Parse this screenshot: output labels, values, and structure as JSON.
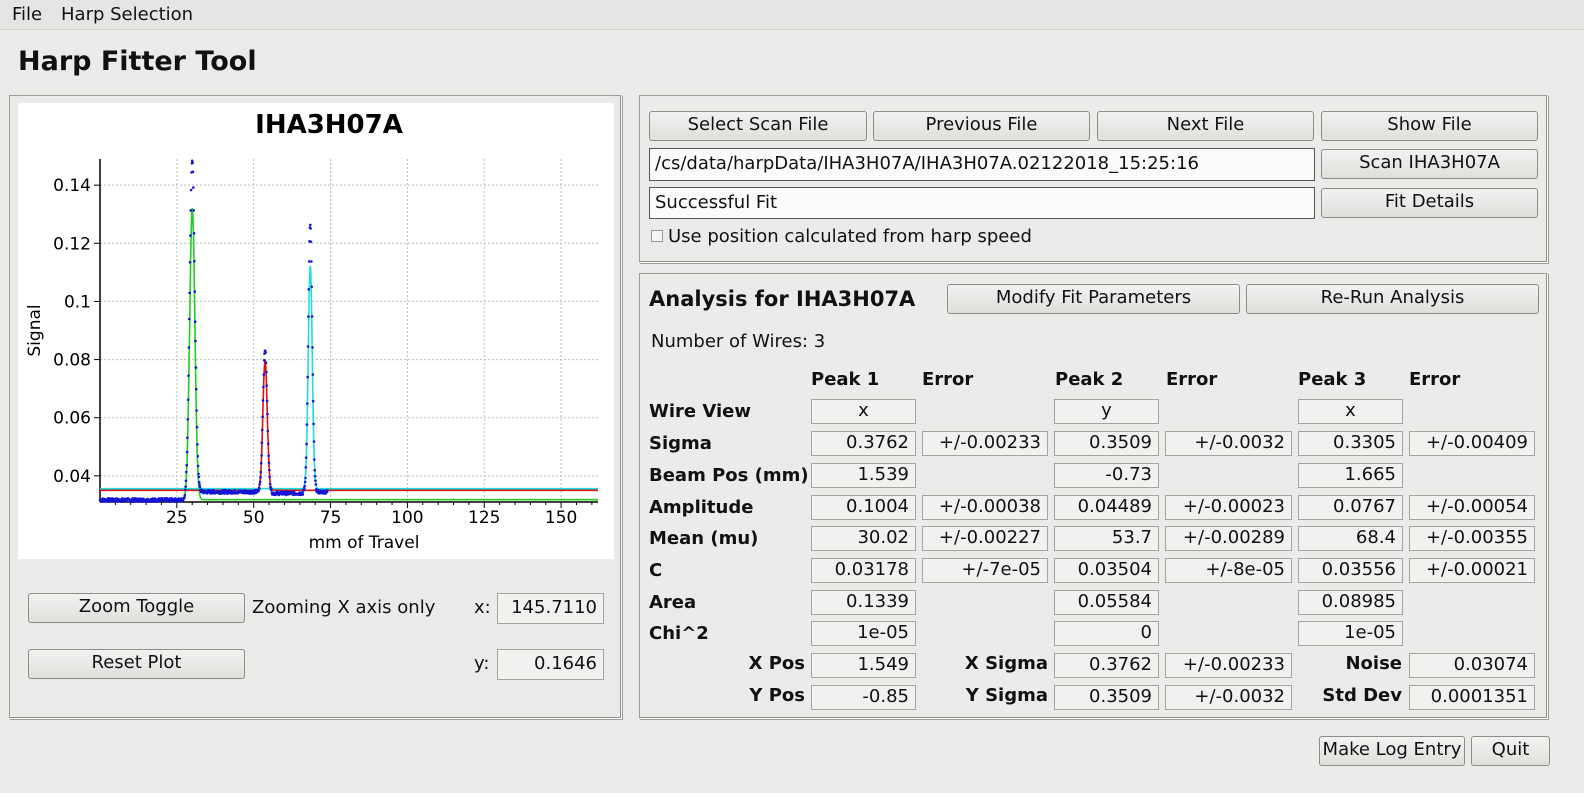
{
  "menu": {
    "file": "File",
    "harp_selection": "Harp Selection"
  },
  "app_title": "Harp Fitter Tool",
  "file_controls": {
    "select_scan": "Select Scan File",
    "previous_file": "Previous File",
    "next_file": "Next File",
    "show_file": "Show File",
    "file_path": "/cs/data/harpData/IHA3H07A/IHA3H07A.02122018_15:25:16",
    "scan_button": "Scan IHA3H07A",
    "status_text": "Successful Fit",
    "fit_details": "Fit Details",
    "use_position_label": "Use position calculated from harp speed",
    "use_position_checked": false
  },
  "plot_controls": {
    "zoom_toggle": "Zoom Toggle",
    "zoom_mode": "Zooming X axis only",
    "reset_plot": "Reset Plot",
    "x_label": "x:",
    "x_value": "145.7110",
    "y_label": "y:",
    "y_value": "0.1646"
  },
  "analysis": {
    "title": "Analysis for IHA3H07A",
    "modify_fit": "Modify Fit Parameters",
    "rerun": "Re-Run Analysis",
    "num_wires": "Number of Wires: 3",
    "headers": [
      "Peak 1",
      "Error",
      "Peak 2",
      "Error",
      "Peak 3",
      "Error"
    ],
    "rows": [
      {
        "label": "Wire View",
        "p1": "x",
        "e1": "",
        "p2": "y",
        "e2": "",
        "p3": "x",
        "e3": ""
      },
      {
        "label": "Sigma",
        "p1": "0.3762",
        "e1": "+/-0.00233",
        "p2": "0.3509",
        "e2": "+/-0.0032",
        "p3": "0.3305",
        "e3": "+/-0.00409"
      },
      {
        "label": "Beam Pos (mm)",
        "p1": "1.539",
        "e1": "",
        "p2": "-0.73",
        "e2": "",
        "p3": "1.665",
        "e3": ""
      },
      {
        "label": "Amplitude",
        "p1": "0.1004",
        "e1": "+/-0.00038",
        "p2": "0.04489",
        "e2": "+/-0.00023",
        "p3": "0.0767",
        "e3": "+/-0.00054"
      },
      {
        "label": "Mean (mu)",
        "p1": "30.02",
        "e1": "+/-0.00227",
        "p2": "53.7",
        "e2": "+/-0.00289",
        "p3": "68.4",
        "e3": "+/-0.00355"
      },
      {
        "label": "C",
        "p1": "0.03178",
        "e1": "+/-7e-05",
        "p2": "0.03504",
        "e2": "+/-8e-05",
        "p3": "0.03556",
        "e3": "+/-0.00021"
      },
      {
        "label": "Area",
        "p1": "0.1339",
        "e1": "",
        "p2": "0.05584",
        "e2": "",
        "p3": "0.08985",
        "e3": ""
      },
      {
        "label": "Chi^2",
        "p1": "1e-05",
        "e1": "",
        "p2": "0",
        "e2": "",
        "p3": "1e-05",
        "e3": ""
      }
    ],
    "summary": {
      "x_pos_label": "X Pos",
      "x_pos": "1.549",
      "y_pos_label": "Y Pos",
      "y_pos": "-0.85",
      "x_sigma_label": "X Sigma",
      "x_sigma": "0.3762",
      "x_sigma_err": "+/-0.00233",
      "y_sigma_label": "Y Sigma",
      "y_sigma": "0.3509",
      "y_sigma_err": "+/-0.0032",
      "noise_label": "Noise",
      "noise": "0.03074",
      "std_dev_label": "Std Dev",
      "std_dev": "0.0001351"
    }
  },
  "footer": {
    "make_log_entry": "Make Log Entry",
    "quit": "Quit"
  },
  "chart_data": {
    "type": "line",
    "title": "IHA3H07A",
    "xlabel": "mm of Travel",
    "ylabel": "Signal",
    "xlim": [
      0,
      162
    ],
    "ylim": [
      0.031,
      0.149
    ],
    "xticks": [
      25,
      50,
      75,
      100,
      125,
      150
    ],
    "yticks": [
      0.04,
      0.06,
      0.08,
      0.1,
      0.12,
      0.14
    ],
    "ytick_labels": [
      "0.04",
      "0.06",
      "0.08",
      "0.1",
      "0.12",
      "0.14"
    ],
    "grid": true,
    "series": [
      {
        "kind": "data",
        "color": "#1515d6",
        "x_range": [
          0,
          74
        ],
        "baseline": 0.0317,
        "peaks": [
          {
            "mu": 30.0,
            "sigma": 0.85,
            "amp": 0.117,
            "base": 0.0317
          },
          {
            "mu": 53.7,
            "sigma": 0.7,
            "amp": 0.049,
            "base": 0.0345
          },
          {
            "mu": 68.4,
            "sigma": 0.65,
            "amp": 0.092,
            "base": 0.0345
          }
        ]
      },
      {
        "kind": "fit",
        "color": "#22cc22",
        "mu": 30.02,
        "sigma": 0.85,
        "amp": 0.1004,
        "base": 0.03178
      },
      {
        "kind": "fit",
        "color": "#dd1111",
        "mu": 53.7,
        "sigma": 0.7,
        "amp": 0.04489,
        "base": 0.03504
      },
      {
        "kind": "fit",
        "color": "#22dddd",
        "mu": 68.4,
        "sigma": 0.65,
        "amp": 0.0767,
        "base": 0.03556
      }
    ]
  }
}
